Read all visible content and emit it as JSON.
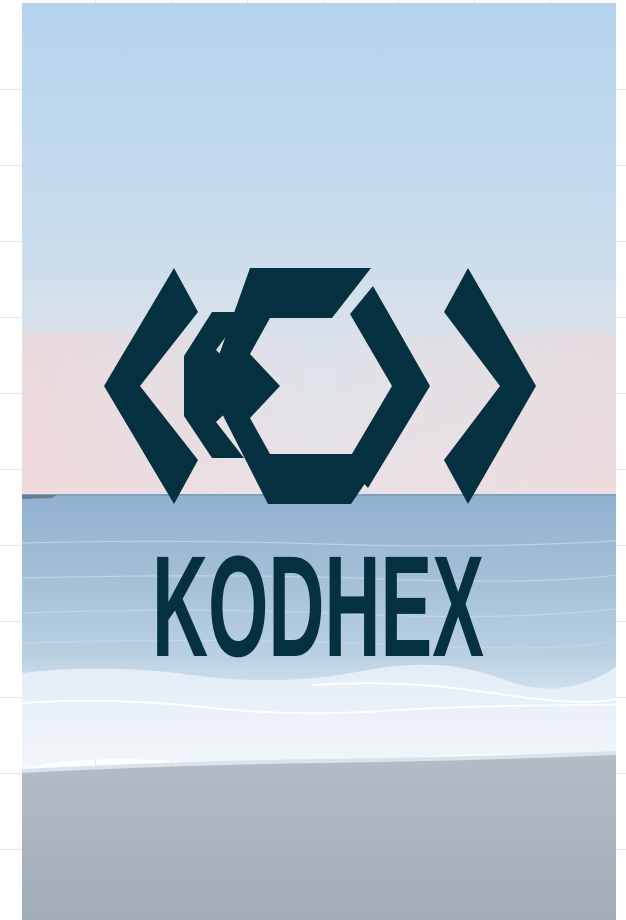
{
  "brand": {
    "name": "KODHEX",
    "logo_color": "#04303f"
  },
  "scene": {
    "sky_top": "#b7d4ee",
    "sky_horizon": "#e6e4e8",
    "sea_far": "#9fbbd3",
    "sea_near": "#c4d8e7",
    "foam": "#eef3f8",
    "sand": "#a6b0bb",
    "icon": "beach-photo"
  }
}
